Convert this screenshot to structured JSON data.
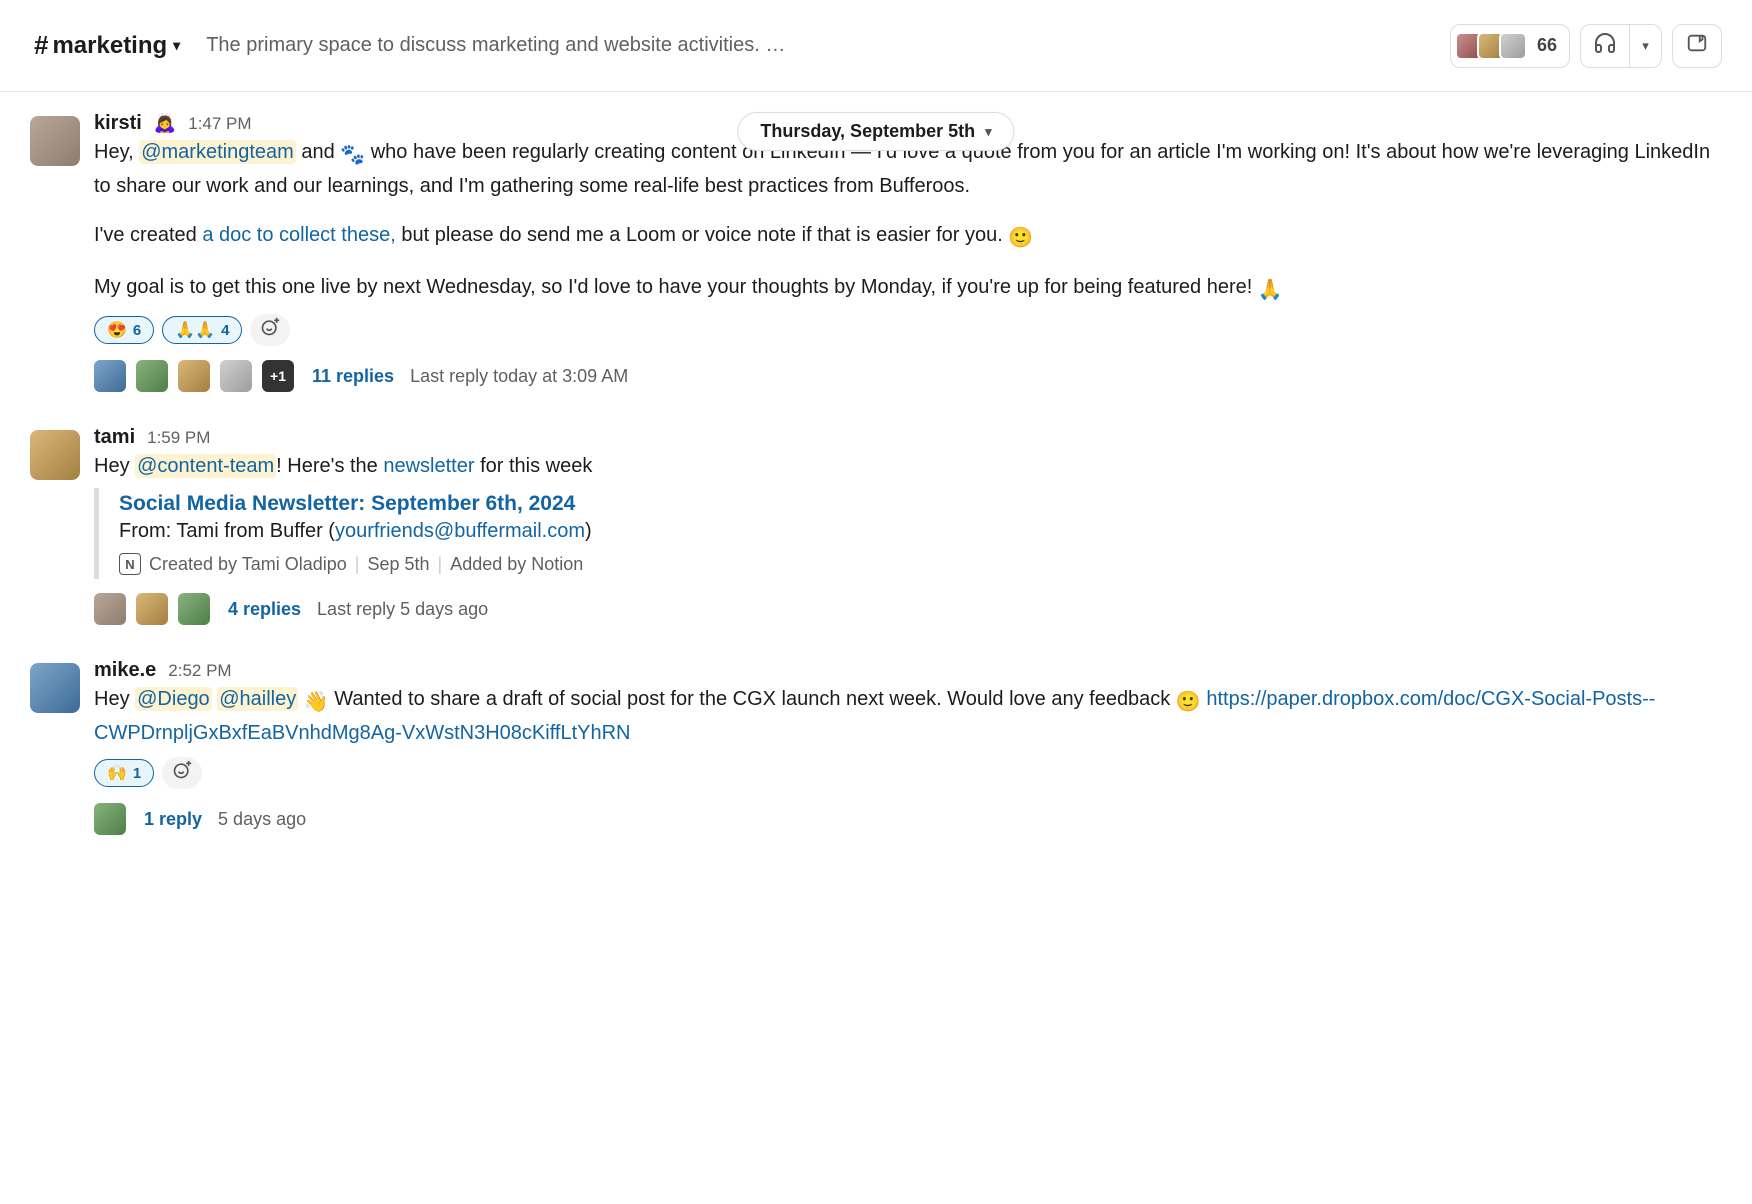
{
  "header": {
    "channel_name": "marketing",
    "topic": "The primary space to discuss marketing and website activities. …",
    "member_count": "66"
  },
  "date_divider": "Thursday, September 5th",
  "messages": [
    {
      "user": "kirsti",
      "status_emoji": "🙇‍♀️",
      "time": "1:47 PM",
      "para1_a": "Hey, ",
      "para1_mention": "@marketingteam",
      "para1_b": " and ",
      "para1_c": " who have been regularly creating content on LinkedIn — I'd love a quote from you for an article I'm working on! It's about how we're leveraging LinkedIn to share our work and our learnings, and I'm gathering some real-life best practices from Bufferoos.",
      "para2_a": "I've created ",
      "para2_link": "a doc to collect these,",
      "para2_b": " but please do send me a Loom or voice note if that is easier for you. ",
      "para3": "My goal is to get this one live by next Wednesday, so I'd love to have your thoughts by Monday, if you're up for being featured here! ",
      "reactions": [
        {
          "emoji": "😍",
          "count": "6",
          "mine": true
        },
        {
          "emoji": "🙏🙏",
          "count": "4",
          "mine": true
        }
      ],
      "thread": {
        "plus": "+1",
        "replies": "11 replies",
        "last": "Last reply today at 3:09 AM"
      }
    },
    {
      "user": "tami",
      "time": "1:59 PM",
      "line_a": "Hey ",
      "line_mention": "@content-team",
      "line_b": "! Here's the ",
      "line_link": "newsletter",
      "line_c": " for this week",
      "attachment": {
        "title": "Social Media Newsletter: September 6th, 2024",
        "from_a": "From: Tami from Buffer (",
        "from_link": "yourfriends@buffermail.com",
        "from_b": ")",
        "meta_created": "Created by Tami Oladipo",
        "meta_date": "Sep 5th",
        "meta_added": "Added by Notion"
      },
      "thread": {
        "replies": "4 replies",
        "last": "Last reply 5 days ago"
      }
    },
    {
      "user": "mike.e",
      "time": "2:52 PM",
      "line_a": "Hey ",
      "mention1": "@Diego",
      "mention2": "@hailley",
      "line_b": " Wanted to share a draft of social post for the CGX launch next week. Would love any feedback ",
      "url": "https://paper.dropbox.com/doc/CGX-Social-Posts--CWPDrnpljGxBxfEaBVnhdMg8Ag-VxWstN3H08cKiffLtYhRN",
      "reactions": [
        {
          "emoji": "🙌",
          "count": "1",
          "mine": true
        }
      ],
      "thread": {
        "replies": "1 reply",
        "last": "5 days ago"
      }
    }
  ]
}
